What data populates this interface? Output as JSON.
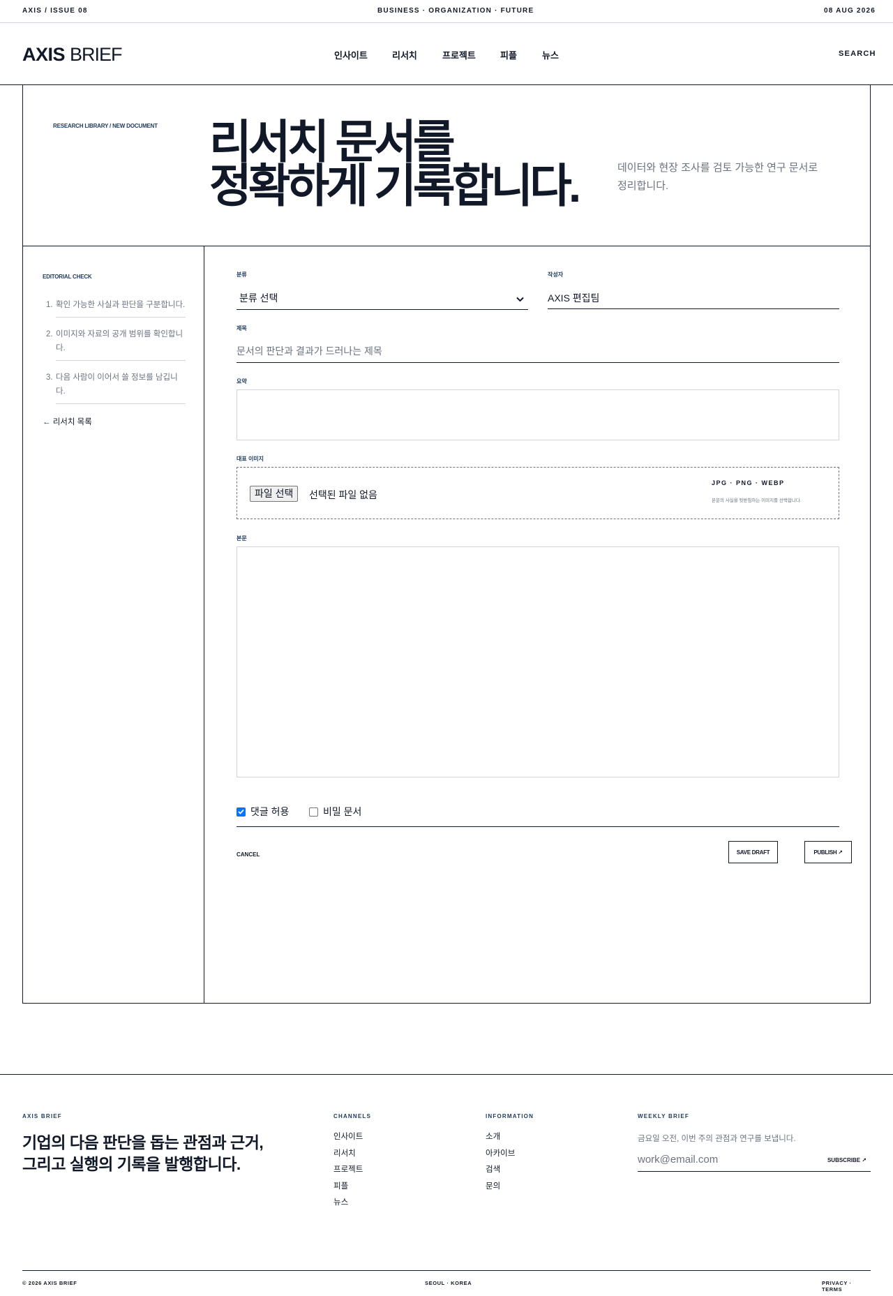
{
  "topbar": {
    "issue": "AXIS / ISSUE 08",
    "tagline": "BUSINESS · ORGANIZATION · FUTURE",
    "date": "08 AUG 2026"
  },
  "header": {
    "logo_bold": "AXIS",
    "logo_light": "BRIEF",
    "nav": [
      "인사이트",
      "리서치",
      "프로젝트",
      "피플",
      "뉴스"
    ],
    "search": "SEARCH"
  },
  "hero": {
    "breadcrumb": "RESEARCH LIBRARY / NEW DOCUMENT",
    "title_line1": "리서치 문서를",
    "title_line2": "정확하게 기록합니다.",
    "description": "데이터와 현장 조사를 검토 가능한 연구 문서로 정리합니다."
  },
  "aside": {
    "label": "EDITORIAL CHECK",
    "items": [
      {
        "num": "1.",
        "text": "확인 가능한 사실과 판단을 구분합니다."
      },
      {
        "num": "2.",
        "text": "이미지와 자료의 공개 범위를 확인합니다."
      },
      {
        "num": "3.",
        "text": "다음 사람이 이어서 쓸 정보를 남깁니다."
      }
    ],
    "back_link": "← 리서치 목록"
  },
  "form": {
    "category_label": "분류",
    "category_value": "분류 선택",
    "author_label": "작성자",
    "author_value": "AXIS 편집팀",
    "title_label": "제목",
    "title_placeholder": "문서의 판단과 결과가 드러나는 제목",
    "title_value": "",
    "summary_label": "요약",
    "summary_value": "",
    "image_label": "대표 이미지",
    "file_button": "파일 선택",
    "file_status": "선택된 파일 없음",
    "formats": "JPG · PNG · WEBP",
    "upload_hint": "본문의 사실을 뒷받침하는 이미지를 선택합니다.",
    "body_label": "본문",
    "body_value": "",
    "allow_comments": "댓글 허용",
    "allow_comments_checked": true,
    "secret_doc": "비밀 문서",
    "secret_doc_checked": false,
    "cancel": "CANCEL",
    "save_draft": "SAVE DRAFT",
    "publish": "PUBLISH ↗"
  },
  "footer": {
    "brand_label": "AXIS BRIEF",
    "tagline_line1": "기업의 다음 판단을 돕는 관점과 근거,",
    "tagline_line2": "그리고 실행의 기록을 발행합니다.",
    "channels_label": "CHANNELS",
    "channels": [
      "인사이트",
      "리서치",
      "프로젝트",
      "피플",
      "뉴스"
    ],
    "information_label": "INFORMATION",
    "information": [
      "소개",
      "아카이브",
      "검색",
      "문의"
    ],
    "weekly_label": "WEEKLY BRIEF",
    "weekly_desc": "금요일 오전, 이번 주의 관점과 연구를 보냅니다.",
    "email_placeholder": "work@email.com",
    "subscribe": "SUBSCRIBE ↗",
    "copyright": "© 2026 AXIS BRIEF",
    "location": "SEOUL · KOREA",
    "legal": "PRIVACY · TERMS"
  },
  "colors": {
    "ink": "#111827",
    "muted": "#6b7280",
    "label_navy": "#1e3a5f",
    "rule_light": "#d1d5db",
    "checkbox_accent": "#0075ff"
  }
}
